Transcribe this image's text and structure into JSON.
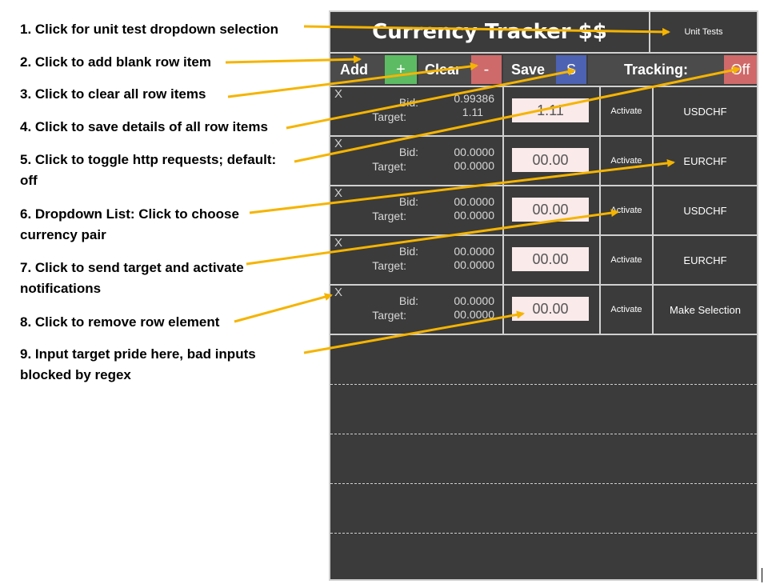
{
  "annotations": [
    "1. Click for unit test dropdown selection",
    "2. Click to add blank row item",
    "3. Click to clear all row items",
    "4.  Click to save details of all row items",
    "5.  Click to toggle http requests; default: off",
    "6. Dropdown List: Click to choose currency pair",
    "7. Click to send target and activate notifications",
    "8. Click to remove row element",
    "9.  Input target pride here, bad inputs blocked by regex"
  ],
  "app": {
    "title": "Currency Tracker $$",
    "unit_tests_label": "Unit Tests",
    "toolbar": {
      "add_label": "Add",
      "add_btn": "+",
      "clear_label": "Clear",
      "clear_btn": "-",
      "save_label": "Save",
      "save_btn": "S",
      "tracking_label": "Tracking:",
      "tracking_btn": "Off"
    },
    "rows": [
      {
        "remove": "X",
        "bid_label": "Bid:",
        "target_label": "Target:",
        "bid": "0.99386",
        "target": "1.11",
        "input": "1.11",
        "activate": "Activate",
        "pair": "USDCHF"
      },
      {
        "remove": "X",
        "bid_label": "Bid:",
        "target_label": "Target:",
        "bid": "00.0000",
        "target": "00.0000",
        "input": "00.00",
        "activate": "Activate",
        "pair": "EURCHF"
      },
      {
        "remove": "X",
        "bid_label": "Bid:",
        "target_label": "Target:",
        "bid": "00.0000",
        "target": "00.0000",
        "input": "00.00",
        "activate": "Activate",
        "pair": "USDCHF"
      },
      {
        "remove": "X",
        "bid_label": "Bid:",
        "target_label": "Target:",
        "bid": "00.0000",
        "target": "00.0000",
        "input": "00.00",
        "activate": "Activate",
        "pair": "EURCHF"
      },
      {
        "remove": "X",
        "bid_label": "Bid:",
        "target_label": "Target:",
        "bid": "00.0000",
        "target": "00.0000",
        "input": "00.00",
        "activate": "Activate",
        "pair": "Make Selection"
      }
    ]
  },
  "colors": {
    "panel_bg": "#3b3b3b",
    "add_green": "#5dbb63",
    "clear_red": "#cf6a6a",
    "save_blue": "#4d62b3",
    "tracking_red": "#d06a6a",
    "input_bg": "#fbeaea",
    "arrow_yellow": "#f5b400"
  }
}
